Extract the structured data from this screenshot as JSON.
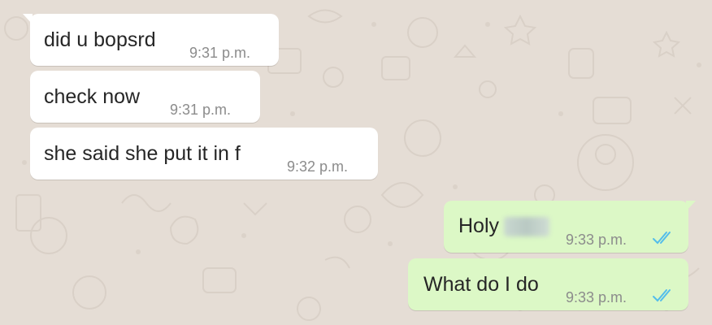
{
  "colors": {
    "background": "#e5ddd5",
    "incoming_bubble": "#ffffff",
    "outgoing_bubble": "#dcf8c6",
    "read_ticks": "#53bdeb"
  },
  "messages": [
    {
      "direction": "incoming",
      "text": "did u bopsrd",
      "time": "9:31 p.m."
    },
    {
      "direction": "incoming",
      "text": "check now",
      "time": "9:31 p.m."
    },
    {
      "direction": "incoming",
      "text": "she said she put it in f",
      "time": "9:32 p.m."
    },
    {
      "direction": "outgoing",
      "text": "Holy",
      "redacted": true,
      "time": "9:33 p.m.",
      "status_icon": "double-check-read-icon"
    },
    {
      "direction": "outgoing",
      "text": "What do I do",
      "time": "9:33 p.m.",
      "status_icon": "double-check-read-icon"
    }
  ]
}
